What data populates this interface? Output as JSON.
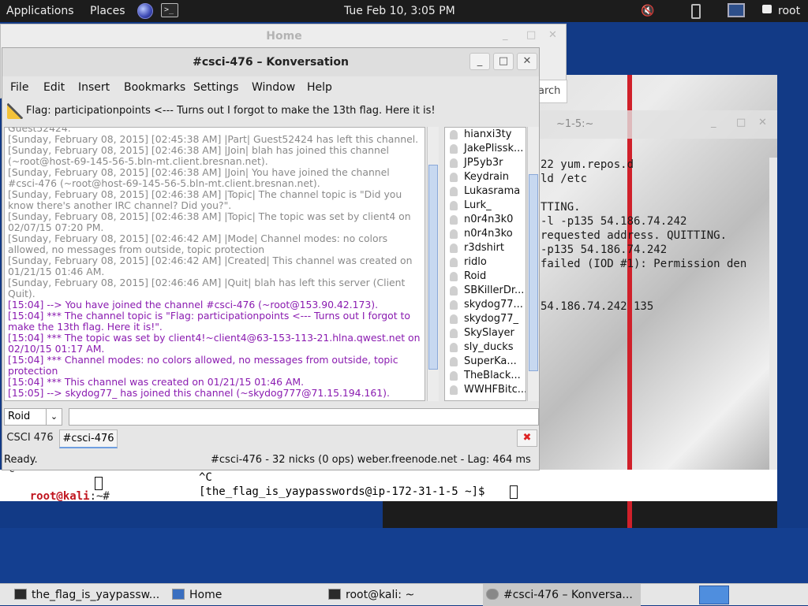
{
  "top_panel": {
    "applications": "Applications",
    "places": "Places",
    "clock": "Tue Feb 10,  3:05 PM",
    "user": "root",
    "terminal_glyph": ">_"
  },
  "home_window": {
    "title": "Home",
    "search_label": "arch"
  },
  "terminal_right": {
    "title": "~1-5:~",
    "lines": [
      "22 yum.repos.d",
      "ld /etc",
      "",
      "TTING.",
      " -l -p135 54.186.74.242",
      " requested address. QUITTING.",
      " -p135 54.186.74.242",
      " failed (IOD #1): Permission den",
      "",
      "",
      " 54.186.74.242 135"
    ],
    "prompt_ctrl": "^C",
    "prompt": "[the_flag_is_yaypasswords@ip-172-31-1-5 ~]$ "
  },
  "root_terminal": {
    "line0": "^C",
    "user": "root@kali",
    "path": ":~# "
  },
  "konversation": {
    "title": "#csci-476 – Konversation",
    "menu": [
      "File",
      "Edit",
      "Insert",
      "Bookmarks",
      "Settings",
      "Window",
      "Help"
    ],
    "topic": "Flag: participationpoints <--- Turns out I forgot to make the 13th flag. Here it is!",
    "chat_lines": [
      {
        "cls": "sys",
        "text": "Guest52424."
      },
      {
        "cls": "sys",
        "text": "[Sunday, February 08, 2015] [02:45:38 AM] |Part| Guest52424 has left this channel."
      },
      {
        "cls": "sys",
        "text": "[Sunday, February 08, 2015] [02:46:38 AM] |Join| blah has joined this channel (~root@host-69-145-56-5.bln-mt.client.bresnan.net)."
      },
      {
        "cls": "sys",
        "text": "[Sunday, February 08, 2015] [02:46:38 AM] |Join| You have joined the channel #csci-476 (~root@host-69-145-56-5.bln-mt.client.bresnan.net)."
      },
      {
        "cls": "sys",
        "text": "[Sunday, February 08, 2015] [02:46:38 AM] |Topic| The channel topic is \"Did you know there's another IRC channel? Did you?\"."
      },
      {
        "cls": "sys",
        "text": "[Sunday, February 08, 2015] [02:46:38 AM] |Topic| The topic was set by client4 on 02/07/15 07:20 PM."
      },
      {
        "cls": "sys",
        "text": "[Sunday, February 08, 2015] [02:46:42 AM] |Mode| Channel modes: no colors allowed, no messages from outside, topic protection"
      },
      {
        "cls": "sys",
        "text": "[Sunday, February 08, 2015] [02:46:42 AM] |Created| This channel was created on 01/21/15 01:46 AM."
      },
      {
        "cls": "sys",
        "text": "[Sunday, February 08, 2015] [02:46:46 AM] |Quit| blah has left this server (Client Quit)."
      },
      {
        "cls": "me",
        "text": "[15:04] --> You have joined the channel #csci-476 (~root@153.90.42.173)."
      },
      {
        "cls": "me",
        "text": "[15:04] *** The channel topic is \"Flag: participationpoints <--- Turns out I forgot to make the 13th flag.  Here it is!\"."
      },
      {
        "cls": "me",
        "text": "[15:04] *** The topic was set by client4!~client4@63-153-113-21.hlna.qwest.net on 02/10/15 01:17 AM."
      },
      {
        "cls": "me",
        "text": "[15:04] *** Channel modes: no colors allowed, no messages from outside, topic protection"
      },
      {
        "cls": "me",
        "text": "[15:04] *** This channel was created on 01/21/15 01:46 AM."
      },
      {
        "cls": "me",
        "text": "[15:05] --> skydog77_ has joined this channel (~skydog777@71.15.194.161)."
      }
    ],
    "nicks": [
      "hianxi3ty",
      "JakePlissk...",
      "JP5yb3r",
      "Keydrain",
      "Lukasrama",
      "Lurk_",
      "n0r4n3k0",
      "n0r4n3ko",
      "r3dshirt",
      "ridlo",
      "Roid",
      "SBKillerDr...",
      "skydog77...",
      "skydog77_",
      "SkySlayer",
      "sly_ducks",
      "SuperKa...",
      "TheBlack...",
      "WWHFBitc..."
    ],
    "nick_select": "Roid",
    "tabs": [
      "CSCI 476",
      "#csci-476"
    ],
    "status_left": "Ready.",
    "status_right": "#csci-476 - 32 nicks (0 ops)  weber.freenode.net - Lag: 464 ms"
  },
  "taskbar": {
    "items": [
      "the_flag_is_yaypassw...",
      "Home",
      "root@kali: ~",
      "#csci-476 – Konversa..."
    ]
  },
  "colors": {
    "panel": "#1c1c1c",
    "desktop": "#123a86",
    "channel_text": "#8a1bb0"
  }
}
